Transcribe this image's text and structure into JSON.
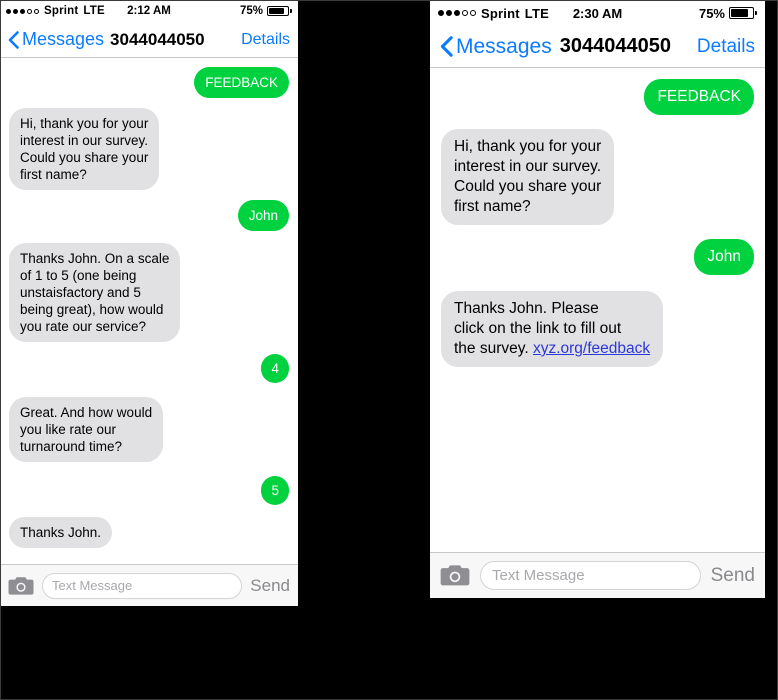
{
  "figure": {
    "caption_left": "",
    "caption_right": ""
  },
  "colors": {
    "outgoing_bubble": "#00d13f",
    "incoming_bubble": "#e1e1e3",
    "accent_blue": "#0b7bff",
    "link_blue": "#2b37d8",
    "backdrop": "#000000"
  },
  "phones": [
    {
      "id": "left",
      "status_bar": {
        "signal_dots_filled": 3,
        "signal_dots_total": 5,
        "carrier": "Sprint",
        "network": "LTE",
        "time": "2:12 AM",
        "battery_percent": "75%"
      },
      "nav_bar": {
        "back_icon": "chevron-left-icon",
        "back_label": "Messages",
        "title": "3044044050",
        "details_label": "Details"
      },
      "messages": [
        {
          "direction": "out",
          "text": "FEEDBACK"
        },
        {
          "direction": "in",
          "text": "Hi, thank you for your\ninterest in our survey.\nCould you share your\nfirst name?"
        },
        {
          "direction": "out",
          "text": "John"
        },
        {
          "direction": "in",
          "text": "Thanks John. On a scale\nof 1 to 5 (one being\nunstaisfactory and 5\nbeing great), how would\nyou rate our service?"
        },
        {
          "direction": "out",
          "text": "4",
          "rating": true
        },
        {
          "direction": "in",
          "text": "Great. And how would\nyou like rate our\nturnaround time?"
        },
        {
          "direction": "out",
          "text": "5",
          "rating": true
        },
        {
          "direction": "in",
          "text": "Thanks John."
        }
      ],
      "composer": {
        "camera_icon": "camera-icon",
        "input_placeholder": "Text Message",
        "input_value": "",
        "send_label": "Send"
      }
    },
    {
      "id": "right",
      "status_bar": {
        "signal_dots_filled": 3,
        "signal_dots_total": 5,
        "carrier": "Sprint",
        "network": "LTE",
        "time": "2:30 AM",
        "battery_percent": "75%"
      },
      "nav_bar": {
        "back_icon": "chevron-left-icon",
        "back_label": "Messages",
        "title": "3044044050",
        "details_label": "Details"
      },
      "messages": [
        {
          "direction": "out",
          "text": "FEEDBACK"
        },
        {
          "direction": "in",
          "text": "Hi, thank you for your\ninterest in our survey.\nCould you share your\nfirst name?"
        },
        {
          "direction": "out",
          "text": "John"
        },
        {
          "direction": "in",
          "text": "Thanks John. Please\nclick on the link to fill out\nthe survey. ",
          "link_text": "xyz.org/feedback"
        }
      ],
      "composer": {
        "camera_icon": "camera-icon",
        "input_placeholder": "Text Message",
        "input_value": "",
        "send_label": "Send"
      }
    }
  ]
}
